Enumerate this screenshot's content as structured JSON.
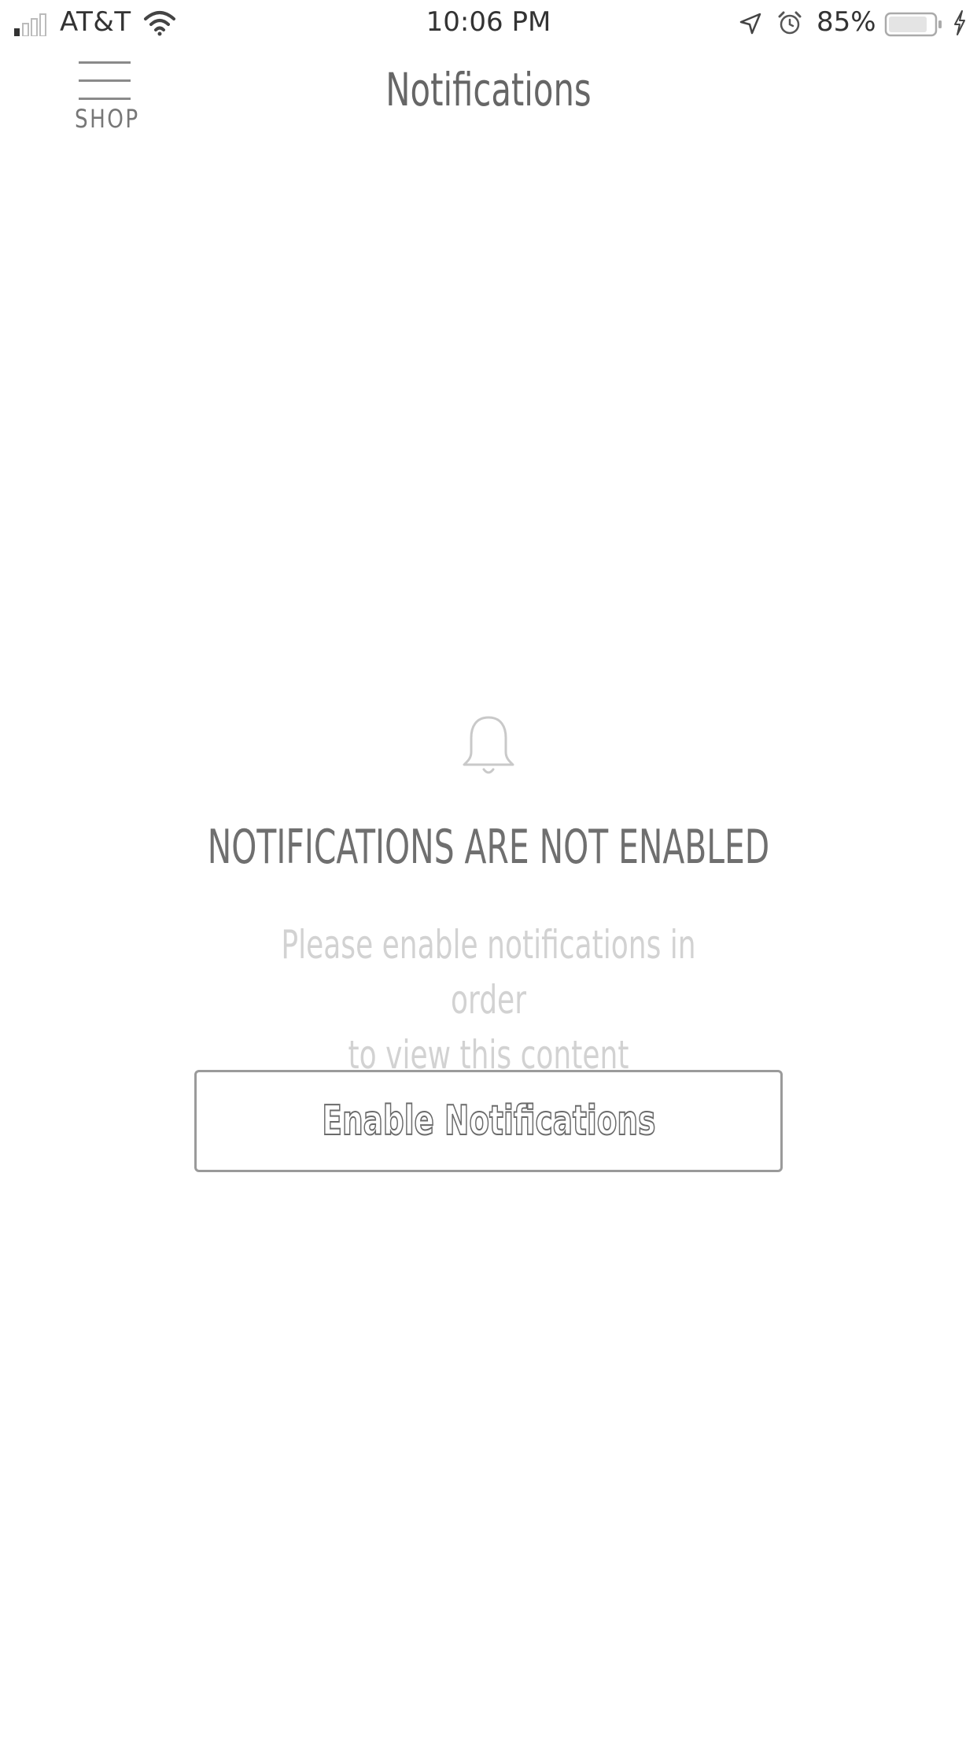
{
  "status_bar": {
    "carrier": "AT&T",
    "time": "10:06 PM",
    "battery_percent": "85%",
    "signal_bars_filled": 1,
    "signal_bars_total": 4,
    "battery_level": 0.85,
    "icons": [
      "signal-icon",
      "wifi-icon",
      "location-icon",
      "alarm-icon",
      "battery-icon",
      "charging-icon"
    ]
  },
  "header": {
    "menu_label": "SHOP",
    "title": "Notifications"
  },
  "empty_state": {
    "icon": "bell-icon",
    "heading": "NOTIFICATIONS ARE NOT ENABLED",
    "message_line1": "Please enable notifications in order",
    "message_line2": "to view this content",
    "button_label": "Enable Notifications"
  },
  "colors": {
    "background": "#ffffff",
    "heading_text": "#6f6f6f",
    "message_text": "#d2d2d2",
    "button_border": "#9a9a9a"
  }
}
